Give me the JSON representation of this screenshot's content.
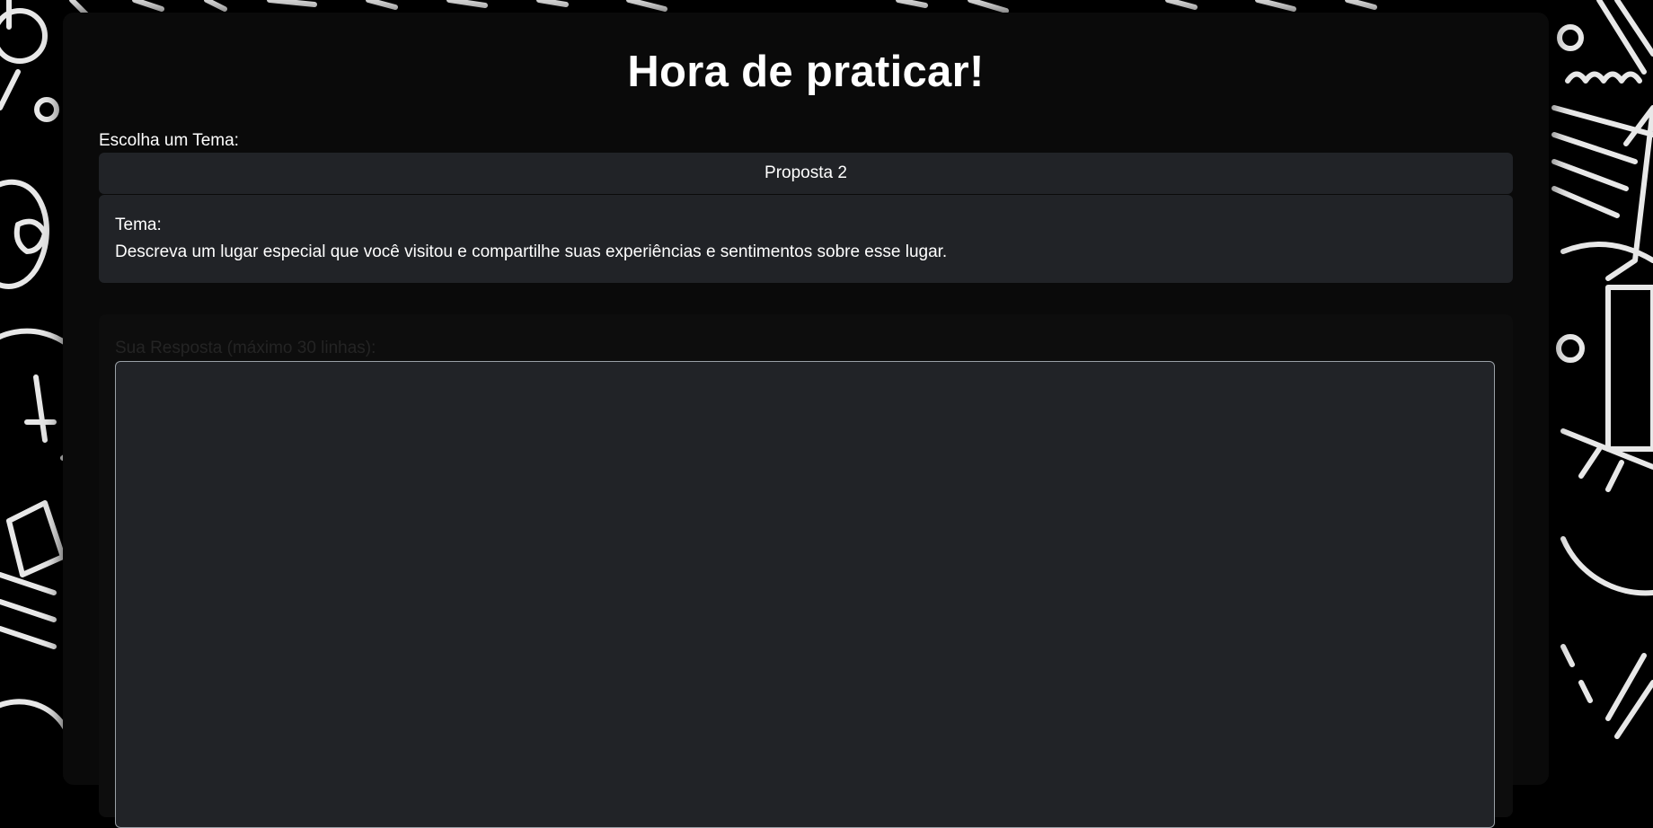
{
  "page": {
    "title": "Hora de praticar!"
  },
  "theme_select": {
    "label": "Escolha um Tema:",
    "selected": "Proposta 2"
  },
  "topic": {
    "label": "Tema:",
    "text": "Descreva um lugar especial que você visitou e compartilhe suas experiências e sentimentos sobre esse lugar."
  },
  "answer": {
    "label": "Sua Resposta (máximo 30 linhas):",
    "value": ""
  },
  "colors": {
    "background": "#000000",
    "panel": "#0a0a0a",
    "field": "#212327",
    "text": "#ffffff"
  },
  "icons": {
    "background_pattern": "school-doodles-pattern"
  }
}
